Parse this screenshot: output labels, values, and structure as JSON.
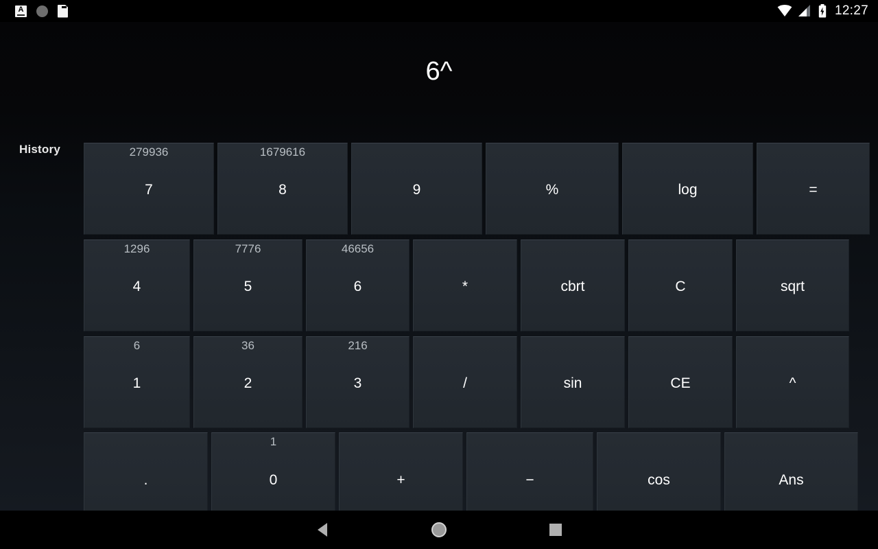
{
  "status_bar": {
    "left_icons": [
      "keyboard-a-icon",
      "circle-icon",
      "sd-card-icon"
    ],
    "keyboard_glyph": "A",
    "right_icons": [
      "wifi-icon",
      "signal-icon",
      "battery-charging-icon"
    ],
    "time": "12:27"
  },
  "display": {
    "expression": "6^"
  },
  "history": {
    "label": "History",
    "entries": []
  },
  "keypad": {
    "rows": [
      {
        "keys": [
          {
            "label": "7",
            "hint": "279936"
          },
          {
            "label": "8",
            "hint": "1679616"
          },
          {
            "label": "9",
            "hint": ""
          },
          {
            "label": "%",
            "hint": ""
          },
          {
            "label": "log",
            "hint": ""
          },
          {
            "label": "=",
            "hint": ""
          }
        ]
      },
      {
        "keys": [
          {
            "label": "4",
            "hint": "1296"
          },
          {
            "label": "5",
            "hint": "7776"
          },
          {
            "label": "6",
            "hint": "46656"
          },
          {
            "label": "*",
            "hint": ""
          },
          {
            "label": "cbrt",
            "hint": ""
          },
          {
            "label": "C",
            "hint": ""
          },
          {
            "label": "sqrt",
            "hint": ""
          }
        ]
      },
      {
        "keys": [
          {
            "label": "1",
            "hint": "6"
          },
          {
            "label": "2",
            "hint": "36"
          },
          {
            "label": "3",
            "hint": "216"
          },
          {
            "label": "/",
            "hint": ""
          },
          {
            "label": "sin",
            "hint": ""
          },
          {
            "label": "CE",
            "hint": ""
          },
          {
            "label": "^",
            "hint": ""
          }
        ]
      },
      {
        "keys": [
          {
            "label": ".",
            "hint": ""
          },
          {
            "label": "0",
            "hint": "1"
          },
          {
            "label": "+",
            "hint": ""
          },
          {
            "label": "−",
            "hint": ""
          },
          {
            "label": "cos",
            "hint": ""
          },
          {
            "label": "Ans",
            "hint": ""
          }
        ]
      }
    ]
  },
  "nav_bar": {
    "buttons": [
      "back-icon",
      "home-icon",
      "recents-icon"
    ]
  },
  "colors": {
    "background": "#000000",
    "key_face": "#242a31",
    "key_highlight": "#3a4149",
    "text_primary": "#ffffff",
    "text_hint": "#b9bfc4"
  }
}
